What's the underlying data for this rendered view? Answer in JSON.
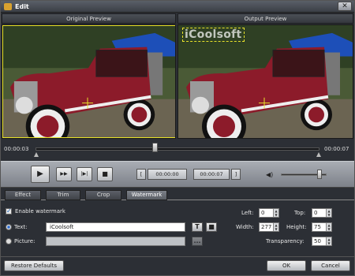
{
  "window": {
    "title": "Edit",
    "close_label": "✕"
  },
  "preview": {
    "original_label": "Original Preview",
    "output_label": "Output Preview",
    "watermark_text": "iCoolsoft"
  },
  "timeline": {
    "start_time": "00:00:03",
    "end_time": "00:00:07",
    "progress_fraction": 0.42
  },
  "controls": {
    "play_icon": "▶",
    "fast_forward_icon": "▶▶",
    "frame_step_icon": "|▶|",
    "stop_icon": "■",
    "start_bracket": "[",
    "start_time": "00:00:00",
    "end_time": "00:00:07",
    "end_bracket": "]",
    "volume_icon": "◀)",
    "volume_level": 0.85
  },
  "tabs": [
    {
      "label": "Effect",
      "active": false
    },
    {
      "label": "Trim",
      "active": false
    },
    {
      "label": "Crop",
      "active": false
    },
    {
      "label": "Watermark",
      "active": true
    }
  ],
  "watermark": {
    "enable_label": "Enable watermark",
    "enabled": true,
    "text_option_label": "Text:",
    "text_value": "iCoolsoft",
    "picture_option_label": "Picture:",
    "font_button_icon": "T",
    "color_button_icon": "■",
    "browse_button_label": "...",
    "left_label": "Left:",
    "left_value": "0",
    "top_label": "Top:",
    "top_value": "0",
    "width_label": "Width:",
    "width_value": "277",
    "height_label": "Height:",
    "height_value": "75",
    "transparency_label": "Transparency:",
    "transparency_value": "50"
  },
  "footer": {
    "restore_label": "Restore Defaults",
    "ok_label": "OK",
    "cancel_label": "Cancel"
  },
  "colors": {
    "selection_frame": "#e8e22a",
    "car_body": "#8c1b2a",
    "accent": "#2a6cd4"
  }
}
